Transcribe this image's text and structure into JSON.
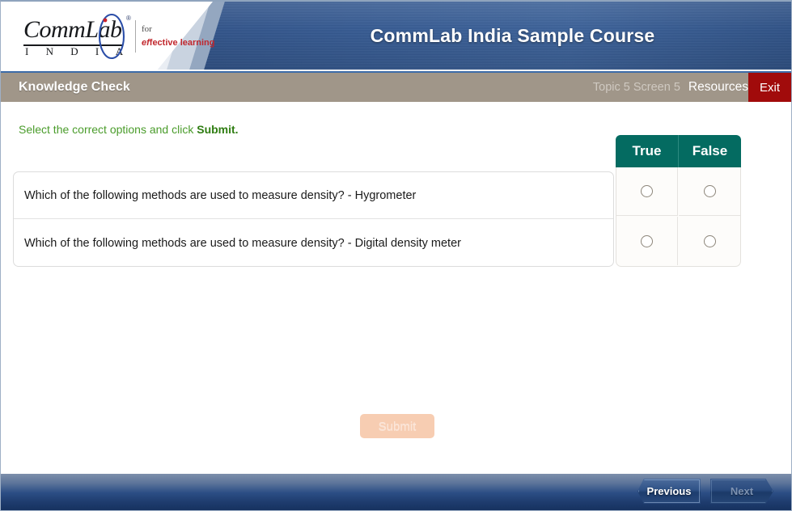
{
  "header": {
    "title": "CommLab India Sample Course",
    "logo": {
      "word": "CommLab",
      "country": "I N D I A",
      "registered": "®",
      "for": "for",
      "tagline_italic": "ef",
      "tagline_rest": "fective learning"
    }
  },
  "navbar": {
    "heading": "Knowledge Check",
    "progress": "Topic 5 Screen 5",
    "resources_label": "Resources",
    "exit_label": "Exit"
  },
  "content": {
    "instruction_prefix": "Select the correct options and click ",
    "instruction_bold": "Submit.",
    "submit_label": "Submit"
  },
  "quiz": {
    "columns": [
      "True",
      "False"
    ],
    "rows": [
      {
        "question": "Which of the following methods are used to measure density? -  Hygrometer",
        "true_selected": false,
        "false_selected": false
      },
      {
        "question": "Which of the following methods are used to measure density? -  Digital density meter",
        "true_selected": false,
        "false_selected": false
      }
    ]
  },
  "footer": {
    "previous_label": "Previous",
    "next_label": "Next"
  },
  "colors": {
    "header_blue": "#2e5288",
    "navbar_taupe": "#a09689",
    "exit_red": "#a10b0b",
    "teal_header": "#046b61",
    "instruction_green": "#4a9c2b",
    "submit_disabled": "#f7cdb2",
    "footer_navy": "#16325f"
  }
}
